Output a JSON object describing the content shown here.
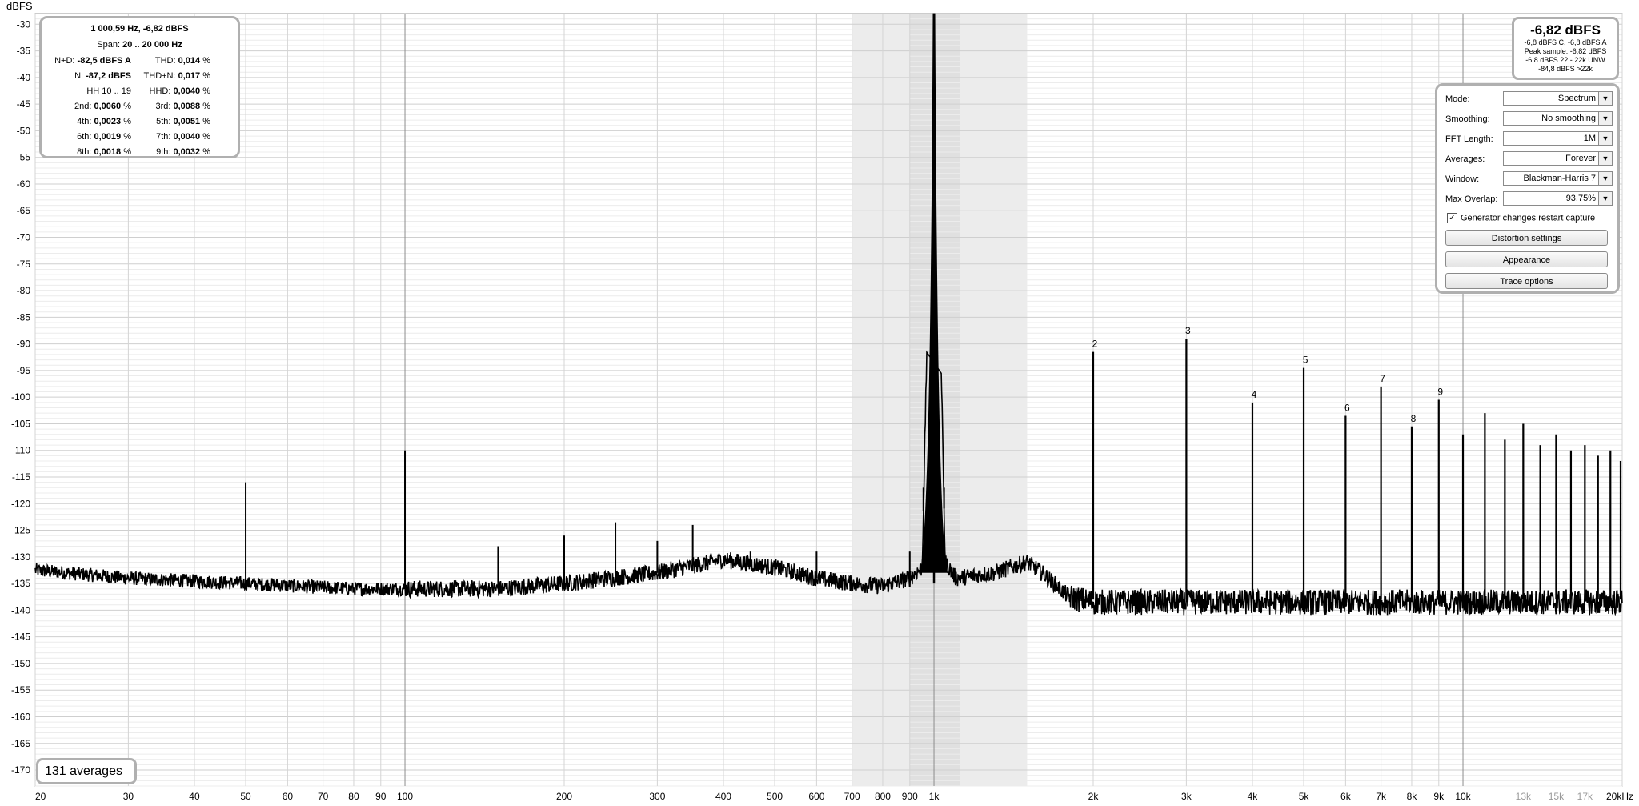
{
  "chart_data": {
    "type": "line",
    "title": "",
    "ylabel": "dBFS",
    "xlabel": "",
    "x_scale": "log",
    "xlim": [
      20,
      20000
    ],
    "ylim": [
      -173,
      -28
    ],
    "y_ticks": [
      "-30",
      "-35",
      "-40",
      "-45",
      "-50",
      "-55",
      "-60",
      "-65",
      "-70",
      "-75",
      "-80",
      "-85",
      "-90",
      "-95",
      "-100",
      "-105",
      "-110",
      "-115",
      "-120",
      "-125",
      "-130",
      "-135",
      "-140",
      "-145",
      "-150",
      "-155",
      "-160",
      "-165",
      "-170"
    ],
    "x_ticks": [
      {
        "v": 20,
        "t": "20",
        "major": true
      },
      {
        "v": 30,
        "t": "30"
      },
      {
        "v": 40,
        "t": "40"
      },
      {
        "v": 50,
        "t": "50"
      },
      {
        "v": 60,
        "t": "60"
      },
      {
        "v": 70,
        "t": "70"
      },
      {
        "v": 80,
        "t": "80"
      },
      {
        "v": 90,
        "t": "90"
      },
      {
        "v": 100,
        "t": "100",
        "major": true
      },
      {
        "v": 200,
        "t": "200"
      },
      {
        "v": 300,
        "t": "300"
      },
      {
        "v": 400,
        "t": "400"
      },
      {
        "v": 500,
        "t": "500"
      },
      {
        "v": 600,
        "t": "600"
      },
      {
        "v": 700,
        "t": "700"
      },
      {
        "v": 800,
        "t": "800"
      },
      {
        "v": 900,
        "t": "900"
      },
      {
        "v": 1000,
        "t": "1k",
        "major": true
      },
      {
        "v": 2000,
        "t": "2k"
      },
      {
        "v": 3000,
        "t": "3k"
      },
      {
        "v": 4000,
        "t": "4k"
      },
      {
        "v": 5000,
        "t": "5k"
      },
      {
        "v": 6000,
        "t": "6k"
      },
      {
        "v": 7000,
        "t": "7k"
      },
      {
        "v": 8000,
        "t": "8k"
      },
      {
        "v": 9000,
        "t": "9k"
      },
      {
        "v": 10000,
        "t": "10k",
        "major": true
      },
      {
        "v": 13000,
        "t": "13k",
        "faint": true
      },
      {
        "v": 15000,
        "t": "15k",
        "faint": true
      },
      {
        "v": 17000,
        "t": "17k",
        "faint": true
      },
      {
        "v": 20000,
        "t": "20kHz"
      }
    ],
    "shaded_band": [
      700,
      1500
    ],
    "floor": [
      [
        20,
        -132.5
      ],
      [
        30,
        -134
      ],
      [
        50,
        -135
      ],
      [
        80,
        -136
      ],
      [
        100,
        -136
      ],
      [
        150,
        -136
      ],
      [
        200,
        -135
      ],
      [
        300,
        -133
      ],
      [
        400,
        -130.5
      ],
      [
        500,
        -132
      ],
      [
        600,
        -134
      ],
      [
        700,
        -135
      ],
      [
        800,
        -135.5
      ],
      [
        900,
        -134
      ],
      [
        950,
        -132
      ],
      [
        1000,
        -28
      ],
      [
        1050,
        -131
      ],
      [
        1100,
        -134
      ],
      [
        1300,
        -133
      ],
      [
        1500,
        -131
      ],
      [
        1600,
        -133
      ],
      [
        1800,
        -137.5
      ],
      [
        2000,
        -138.5
      ],
      [
        5000,
        -138.5
      ],
      [
        20000,
        -138.5
      ]
    ],
    "spurs": [
      {
        "f": 50,
        "db": -116
      },
      {
        "f": 100,
        "db": -110
      },
      {
        "f": 150,
        "db": -128
      },
      {
        "f": 200,
        "db": -126
      },
      {
        "f": 250,
        "db": -123.5
      },
      {
        "f": 300,
        "db": -127
      },
      {
        "f": 350,
        "db": -124
      },
      {
        "f": 450,
        "db": -129
      },
      {
        "f": 600,
        "db": -129
      },
      {
        "f": 900,
        "db": -129
      },
      {
        "f": 955,
        "db": -117
      },
      {
        "f": 1045,
        "db": -117
      }
    ],
    "harmonics": [
      {
        "f": 2000,
        "db": -91.5,
        "label": "2"
      },
      {
        "f": 3000,
        "db": -89,
        "label": "3"
      },
      {
        "f": 4000,
        "db": -101,
        "label": "4"
      },
      {
        "f": 5000,
        "db": -94.5,
        "label": "5"
      },
      {
        "f": 6000,
        "db": -103.5,
        "label": "6"
      },
      {
        "f": 7000,
        "db": -98,
        "label": "7"
      },
      {
        "f": 8000,
        "db": -105.5,
        "label": "8"
      },
      {
        "f": 9000,
        "db": -100.5,
        "label": "9"
      },
      {
        "f": 10000,
        "db": -107,
        "label": ""
      },
      {
        "f": 11000,
        "db": -103,
        "label": ""
      },
      {
        "f": 12000,
        "db": -108,
        "label": ""
      },
      {
        "f": 13000,
        "db": -105,
        "label": ""
      },
      {
        "f": 14000,
        "db": -109,
        "label": ""
      },
      {
        "f": 15000,
        "db": -107,
        "label": ""
      },
      {
        "f": 16000,
        "db": -110,
        "label": ""
      },
      {
        "f": 17000,
        "db": -109,
        "label": ""
      },
      {
        "f": 18000,
        "db": -111,
        "label": ""
      },
      {
        "f": 19000,
        "db": -110,
        "label": ""
      },
      {
        "f": 20000,
        "db": -112,
        "label": ""
      }
    ],
    "fundamental": {
      "f": 1000,
      "db": -6.82
    }
  },
  "axis": {
    "y_unit": "dBFS"
  },
  "info": {
    "header": "1 000,59 Hz, -6,82 dBFS",
    "span_label": "Span:",
    "span_value": "20 .. 20 000 Hz",
    "rows": [
      {
        "l1": "N+D:",
        "v1": "-82,5 dBFS A",
        "l2": "THD:",
        "v2": "0,014",
        "u2": "%"
      },
      {
        "l1": "N:",
        "v1": "-87,2 dBFS",
        "l2": "THD+N:",
        "v2": "0,017",
        "u2": "%"
      },
      {
        "l1": "HH 10 .. 19",
        "v1": "",
        "l2": "HHD:",
        "v2": "0,0040",
        "u2": "%"
      },
      {
        "l1": "2nd:",
        "v1": "0,0060",
        "u1": "%",
        "l2": "3rd:",
        "v2": "0,0088",
        "u2": "%"
      },
      {
        "l1": "4th:",
        "v1": "0,0023",
        "u1": "%",
        "l2": "5th:",
        "v2": "0,0051",
        "u2": "%"
      },
      {
        "l1": "6th:",
        "v1": "0,0019",
        "u1": "%",
        "l2": "7th:",
        "v2": "0,0040",
        "u2": "%"
      },
      {
        "l1": "8th:",
        "v1": "0,0018",
        "u1": "%",
        "l2": "9th:",
        "v2": "0,0032",
        "u2": "%"
      }
    ]
  },
  "level": {
    "main": "-6,82 dBFS",
    "lines": [
      "-6,8 dBFS C, -6,8 dBFS A",
      "Peak sample: -6,82 dBFS",
      "-6,8 dBFS 22 - 22k UNW",
      "-84,8 dBFS >22k"
    ]
  },
  "controls": {
    "mode_label": "Mode:",
    "mode_value": "Spectrum",
    "smoothing_label": "Smoothing:",
    "smoothing_value": "No  smoothing",
    "fft_label": "FFT Length:",
    "fft_value": "1M",
    "averages_label": "Averages:",
    "averages_value": "Forever",
    "window_label": "Window:",
    "window_value": "Blackman-Harris 7",
    "overlap_label": "Max Overlap:",
    "overlap_value": "93.75%",
    "restart_label": "Generator changes restart capture",
    "distortion_button": "Distortion settings",
    "appearance_button": "Appearance",
    "trace_button": "Trace options"
  },
  "averages_count": "131 averages",
  "colors": {
    "trace": "#000000",
    "grid_minor": "#e2e2e2",
    "grid_major": "#c8c8c8",
    "band": "#ececec",
    "panel_border": "#b0b0b0"
  }
}
